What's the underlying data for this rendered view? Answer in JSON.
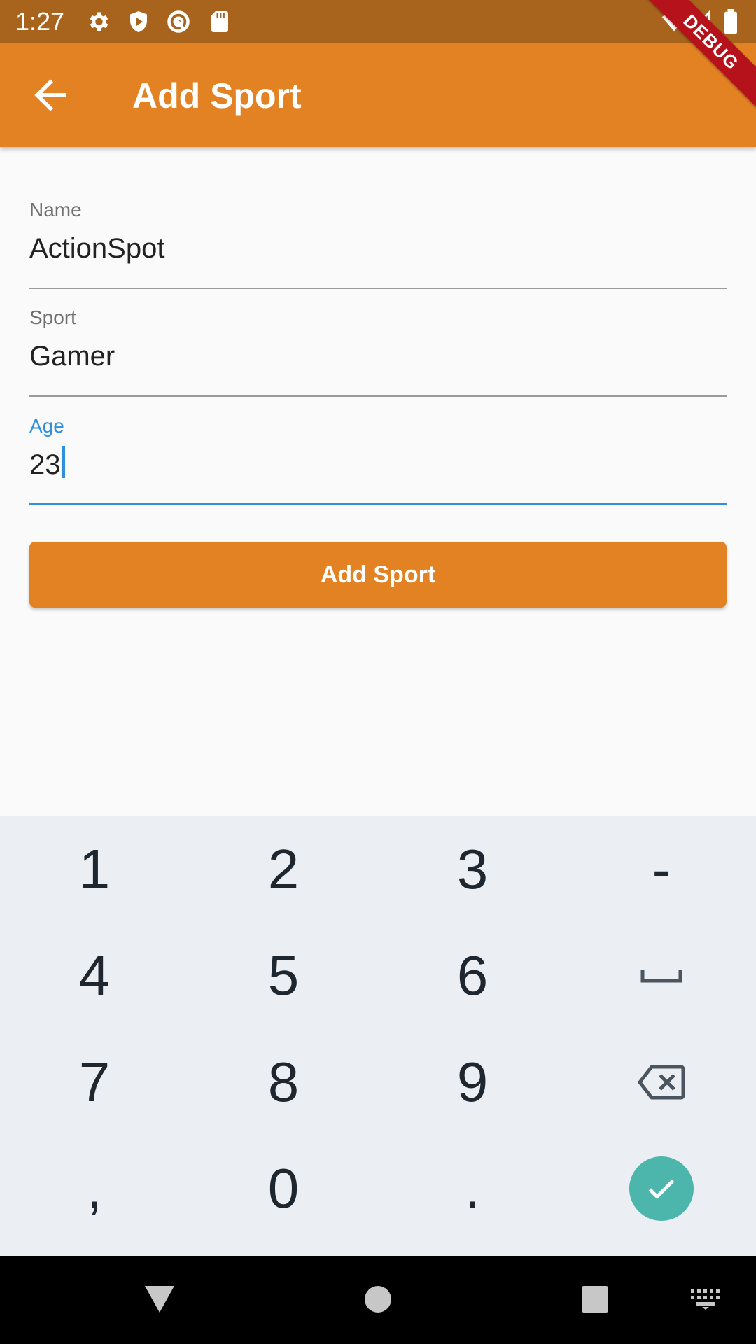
{
  "status_bar": {
    "time": "1:27",
    "left_icons": [
      "gear-icon",
      "shield-icon",
      "at-sign-icon",
      "sd-card-icon"
    ],
    "right_icons": [
      "wifi-icon",
      "signal-icon",
      "battery-icon"
    ]
  },
  "debug_banner": {
    "text": "DEBUG",
    "color": "#b5121b"
  },
  "app_bar": {
    "title": "Add Sport",
    "back_icon": "arrow-back-icon",
    "color": "#e28222"
  },
  "form": {
    "name": {
      "label": "Name",
      "value": "ActionSpot"
    },
    "sport": {
      "label": "Sport",
      "value": "Gamer"
    },
    "age": {
      "label": "Age",
      "value": "23",
      "focused": true
    },
    "submit_label": "Add Sport",
    "focus_color": "#2f8fde"
  },
  "keyboard": {
    "rows": [
      [
        "1",
        "2",
        "3",
        "-"
      ],
      [
        "4",
        "5",
        "6",
        "space"
      ],
      [
        "7",
        "8",
        "9",
        "backspace"
      ],
      [
        ",",
        "0",
        ".",
        "done"
      ]
    ],
    "done_color": "#4db6ac"
  },
  "nav_bar": {
    "buttons": [
      "back-triangle-icon",
      "home-circle-icon",
      "recents-square-icon",
      "keyboard-switch-icon"
    ]
  }
}
